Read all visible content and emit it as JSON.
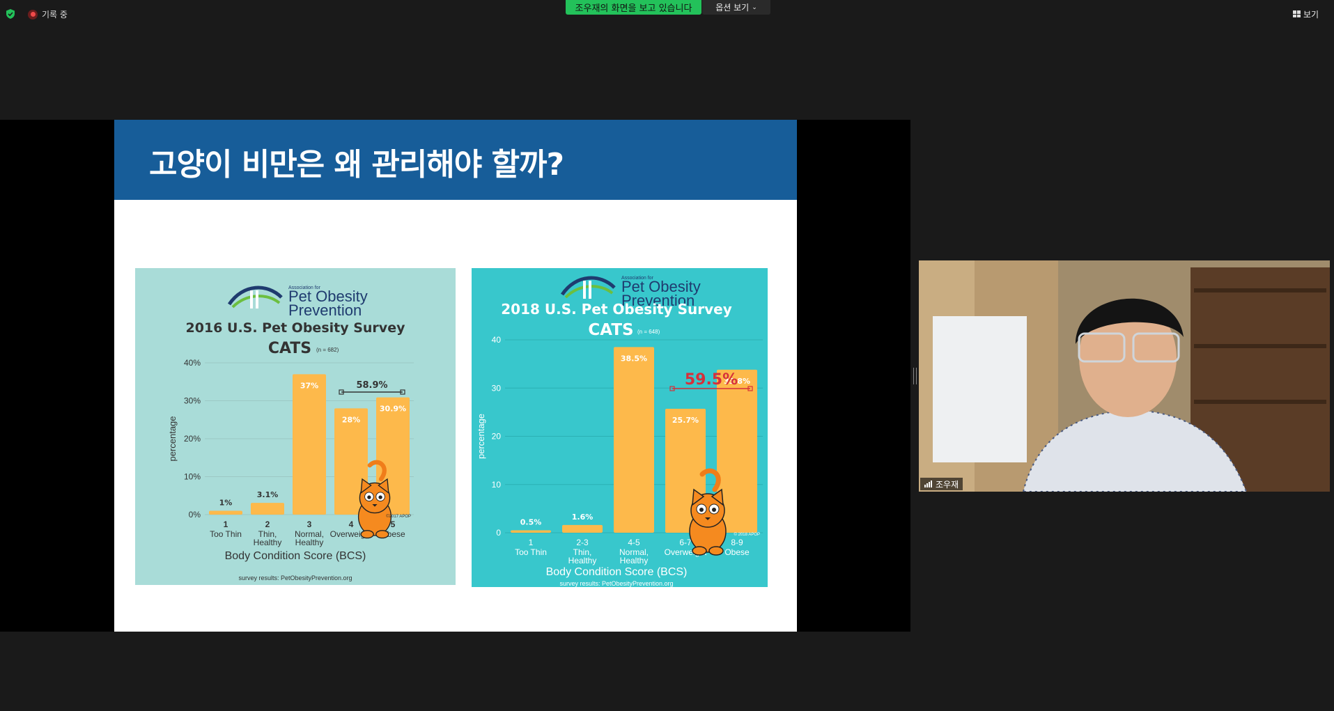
{
  "topbar": {
    "recording_label": "기록 중",
    "share_banner": "조우재의 화면을 보고 있습니다",
    "options_label": "옵션 보기",
    "view_label": "보기"
  },
  "slide": {
    "title": "고양이 비만은 왜 관리해야 할까?"
  },
  "participant": {
    "name": "조우재"
  },
  "chart_data": [
    {
      "type": "bar",
      "org_small": "Association for",
      "org_name_1": "Pet Obesity",
      "org_name_2": "Prevention",
      "title": "2016 U.S. Pet Obesity Survey",
      "subtitle": "CATS",
      "n_label": "(n = 682)",
      "categories_num": [
        "1",
        "2",
        "3",
        "4",
        "5"
      ],
      "categories_text": [
        [
          "Too Thin"
        ],
        [
          "Thin,",
          "Healthy"
        ],
        [
          "Normal,",
          "Healthy"
        ],
        [
          "Overweight"
        ],
        [
          "Obese"
        ]
      ],
      "values": [
        1,
        3.1,
        37,
        28,
        30.9
      ],
      "value_labels": [
        "1%",
        "3.1%",
        "37%",
        "28%",
        "30.9%"
      ],
      "ylim": [
        0,
        40
      ],
      "yticks": [
        "0%",
        "10%",
        "20%",
        "30%",
        "40%"
      ],
      "ylabel": "percentage",
      "xlabel": "Body Condition Score (BCS)",
      "bracket_label": "58.9%",
      "copyright": "©2017 APOP",
      "footer": "survey results: PetObesityPrevention.org",
      "bar_color": "#fdb94b"
    },
    {
      "type": "bar",
      "org_small": "Association for",
      "org_name_1": "Pet Obesity",
      "org_name_2": "Prevention",
      "title": "2018 U.S. Pet Obesity Survey",
      "subtitle": "CATS",
      "n_label": "(n = 648)",
      "categories_num": [
        "1",
        "2-3",
        "4-5",
        "6-7",
        "8-9"
      ],
      "categories_text": [
        [
          "Too Thin"
        ],
        [
          "Thin,",
          "Healthy"
        ],
        [
          "Normal,",
          "Healthy"
        ],
        [
          "Overweight"
        ],
        [
          "Obese"
        ]
      ],
      "values": [
        0.5,
        1.6,
        38.5,
        25.7,
        33.8
      ],
      "value_labels": [
        "0.5%",
        "1.6%",
        "38.5%",
        "25.7%",
        "33.8%"
      ],
      "ylim": [
        0,
        40
      ],
      "yticks": [
        "0",
        "10",
        "20",
        "30",
        "40"
      ],
      "ylabel": "percentage",
      "xlabel": "Body Condition Score (BCS)",
      "bracket_label": "59.5%",
      "copyright": "© 2018 APOP",
      "footer": "survey results: PetObesityPrevention.org",
      "bar_color": "#fdb94b",
      "bracket_color": "#d6303a"
    }
  ],
  "colors": {
    "share_banner": "#23c15a",
    "slide_header": "#175d99",
    "chart1_bg": "#a9dcd8",
    "chart2_bg": "#38c7cc"
  }
}
